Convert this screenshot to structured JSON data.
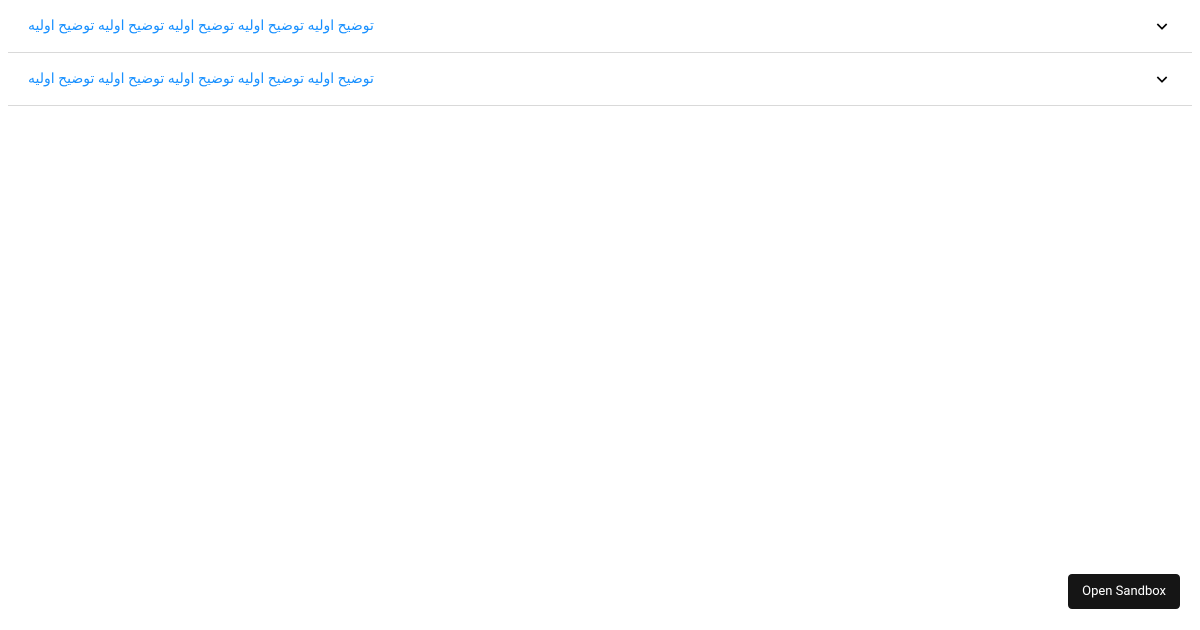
{
  "accordion": {
    "items": [
      {
        "title": "توضیح اولیه توضیح اولیه توضیح اولیه توضیح اولیه توضیح اولیه"
      },
      {
        "title": "توضیح اولیه توضیح اولیه توضیح اولیه توضیح اولیه توضیح اولیه"
      }
    ]
  },
  "footer": {
    "open_sandbox_label": "Open Sandbox"
  },
  "colors": {
    "link": "#1890ff",
    "border": "#d9d9d9",
    "button_bg": "#151515",
    "button_text": "#ffffff"
  }
}
